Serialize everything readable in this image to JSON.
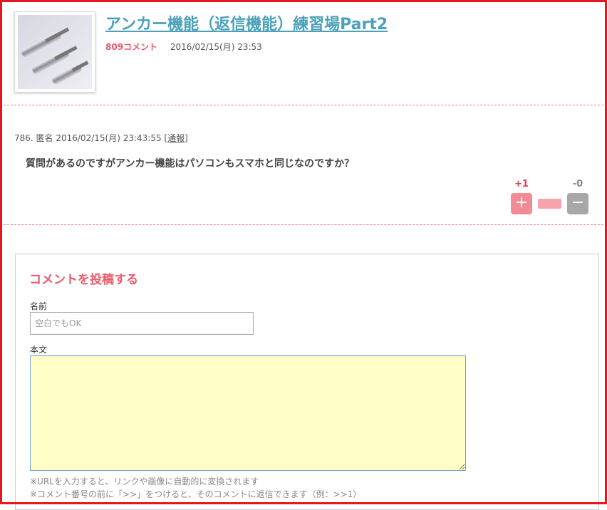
{
  "post": {
    "thumbnail_icon": "anchor-bolts-photo",
    "title": "アンカー機能（返信機能）練習場Part2",
    "comment_count": "809コメント",
    "date": "2016/02/15(月) 23:53"
  },
  "comment": {
    "header": "786. 匿名 2016/02/15(月) 23:43:55 [",
    "report_label": "通報",
    "header_end": "]",
    "body": "質問があるのですがアンカー機能はパソコンもスマホと同じなのですか？",
    "plus_count": "+1",
    "minus_count": "-0",
    "plus_symbol": "+",
    "minus_symbol": "−"
  },
  "form": {
    "title": "コメントを投稿する",
    "name_label": "名前",
    "name_placeholder": "空白でもOK",
    "body_label": "本文",
    "note1": "※URLを入力すると、リンクや画像に自動的に変換されます",
    "note2": "※コメント番号の前に「>>」をつけると、そのコメントに返信できます（例：>>1）"
  },
  "colors": {
    "frame": "#e8141e",
    "title_link": "#4aa1b9",
    "accent": "#ea5a6b",
    "plus": "#f28b96",
    "minus": "#a8a8a8",
    "textarea_bg": "#ffffc8"
  }
}
